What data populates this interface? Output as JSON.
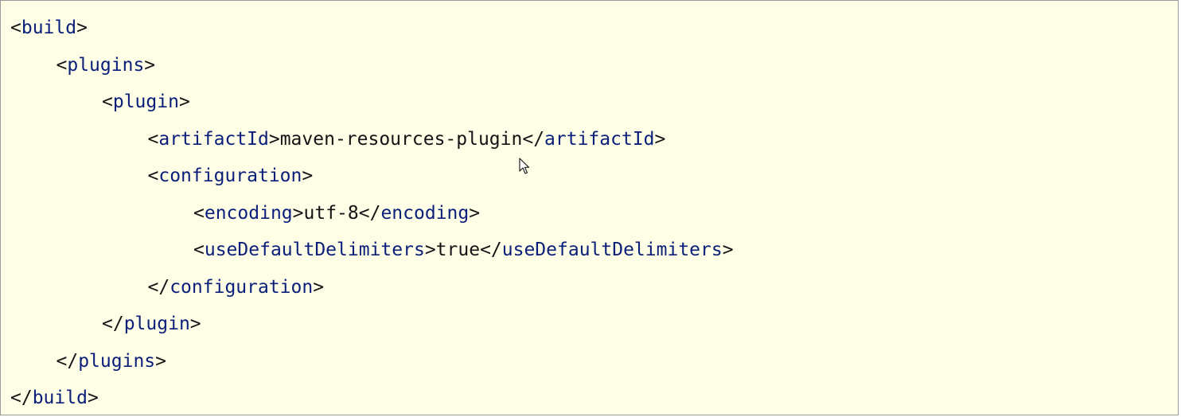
{
  "code": {
    "lines": [
      {
        "indent": 0,
        "close": false,
        "tag": "build",
        "text": "",
        "end_tag": ""
      },
      {
        "indent": 1,
        "close": false,
        "tag": "plugins",
        "text": "",
        "end_tag": ""
      },
      {
        "indent": 2,
        "close": false,
        "tag": "plugin",
        "text": "",
        "end_tag": ""
      },
      {
        "indent": 3,
        "close": false,
        "tag": "artifactId",
        "text": "maven-resources-plugin",
        "end_tag": "artifactId"
      },
      {
        "indent": 3,
        "close": false,
        "tag": "configuration",
        "text": "",
        "end_tag": ""
      },
      {
        "indent": 4,
        "close": false,
        "tag": "encoding",
        "text": "utf-8",
        "end_tag": "encoding"
      },
      {
        "indent": 4,
        "close": false,
        "tag": "useDefaultDelimiters",
        "text": "true",
        "end_tag": "useDefaultDelimiters"
      },
      {
        "indent": 3,
        "close": true,
        "tag": "configuration",
        "text": "",
        "end_tag": ""
      },
      {
        "indent": 2,
        "close": true,
        "tag": "plugin",
        "text": "",
        "end_tag": ""
      },
      {
        "indent": 1,
        "close": true,
        "tag": "plugins",
        "text": "",
        "end_tag": ""
      },
      {
        "indent": 0,
        "close": true,
        "tag": "build",
        "text": "",
        "end_tag": ""
      }
    ]
  },
  "colors": {
    "background": "#fefde6",
    "tag": "#0b1f7a",
    "text": "#141414"
  },
  "icons": {
    "cursor": "mouse-pointer-icon"
  }
}
